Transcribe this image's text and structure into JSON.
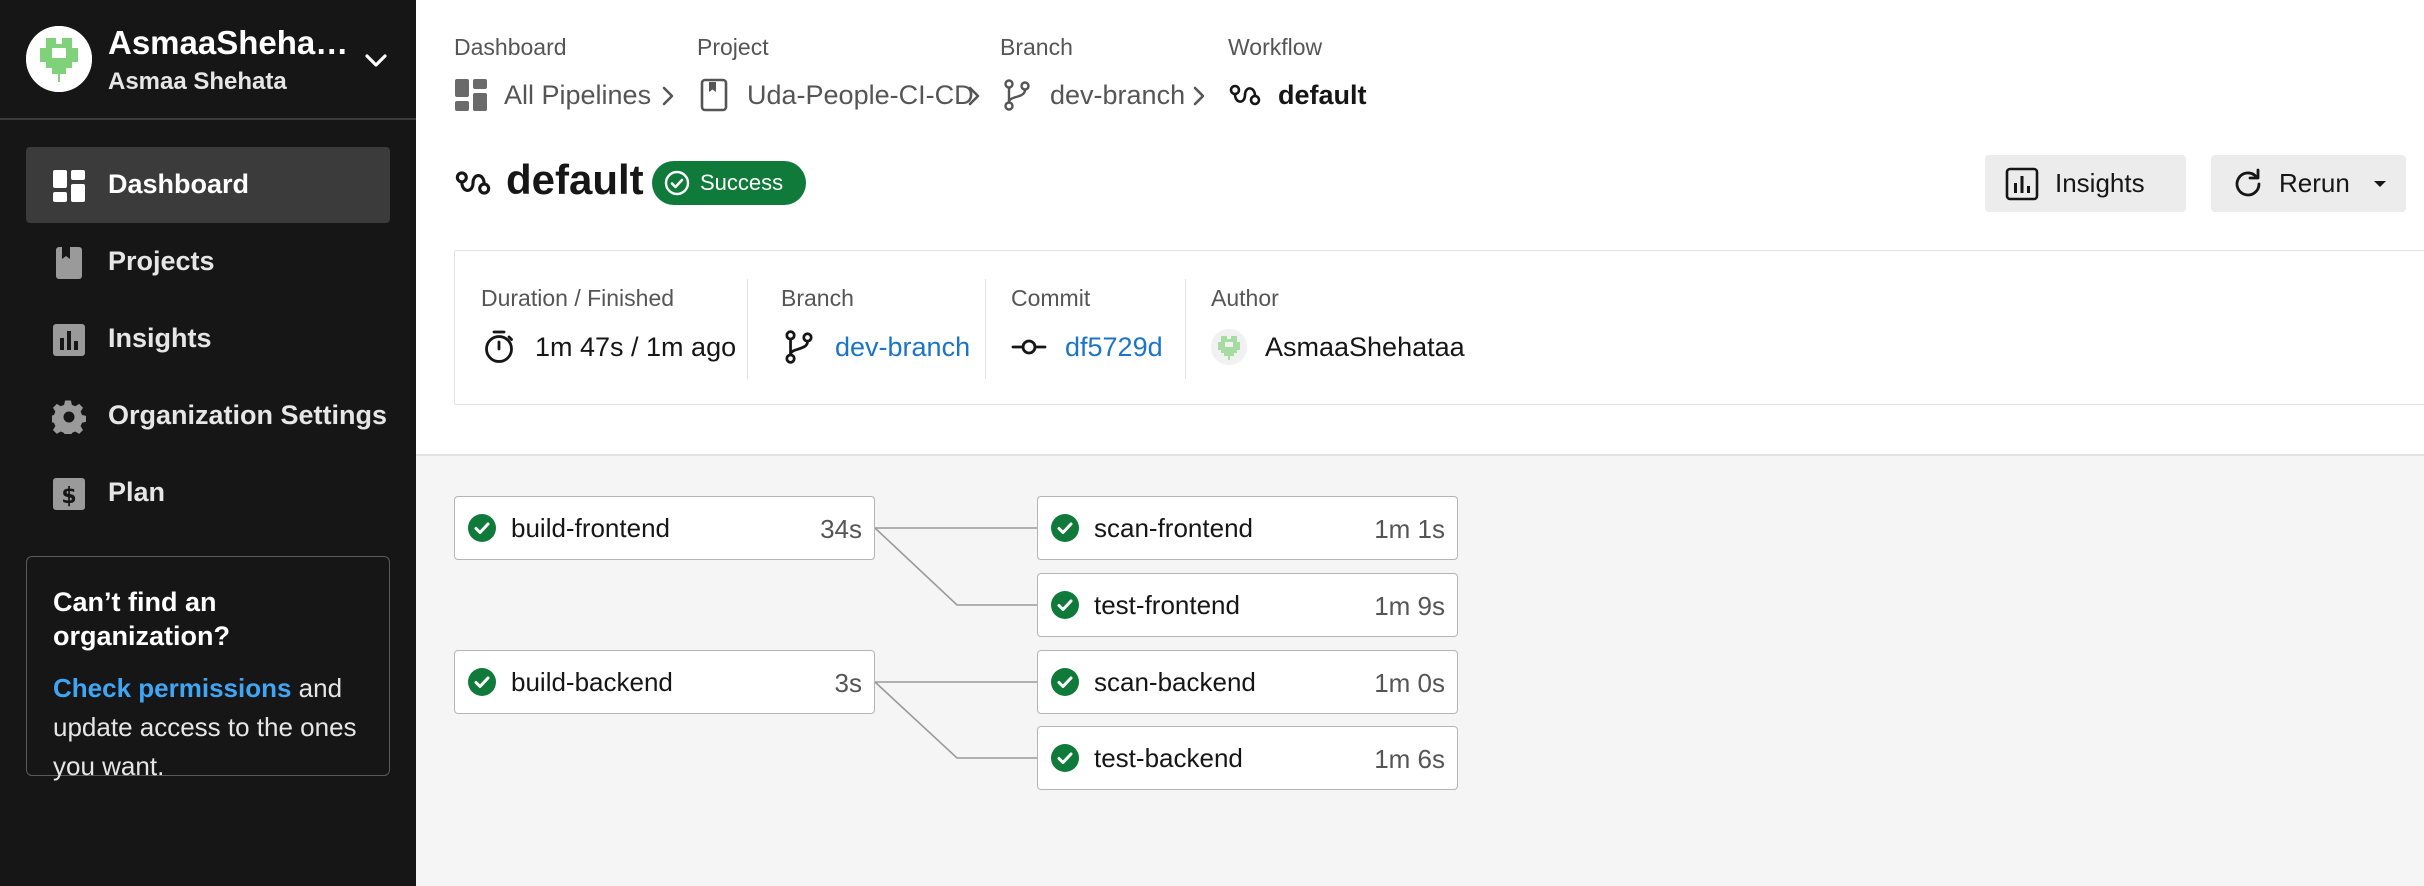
{
  "sidebar": {
    "org_name": "AsmaaShehat…",
    "org_user": "Asmaa Shehata",
    "nav": [
      {
        "label": "Dashboard",
        "icon": "dashboard-icon",
        "active": true
      },
      {
        "label": "Projects",
        "icon": "projects-icon",
        "active": false
      },
      {
        "label": "Insights",
        "icon": "insights-icon",
        "active": false
      },
      {
        "label": "Organization Settings",
        "icon": "gear-icon",
        "active": false
      },
      {
        "label": "Plan",
        "icon": "plan-icon",
        "active": false
      }
    ],
    "help": {
      "title": "Can’t find an organization?",
      "link": "Check permissions",
      "text": " and update access to the ones you want."
    }
  },
  "breadcrumb": [
    {
      "label": "Dashboard",
      "value": "All Pipelines",
      "icon": "pipelines-icon"
    },
    {
      "label": "Project",
      "value": "Uda-People-CI-CD",
      "icon": "project-icon"
    },
    {
      "label": "Branch",
      "value": "dev-branch",
      "icon": "branch-icon"
    },
    {
      "label": "Workflow",
      "value": "default",
      "icon": "workflow-icon"
    }
  ],
  "workflow": {
    "title": "default",
    "status": "Success"
  },
  "actions": {
    "insights_label": "Insights",
    "rerun_label": "Rerun"
  },
  "info": {
    "duration_label": "Duration / Finished",
    "duration_value": "1m 47s / 1m ago",
    "branch_label": "Branch",
    "branch_value": "dev-branch",
    "commit_label": "Commit",
    "commit_value": "df5729d",
    "author_label": "Author",
    "author_value": "AsmaaShehataa"
  },
  "jobs": {
    "build_frontend": {
      "name": "build-frontend",
      "duration": "34s",
      "status": "success"
    },
    "build_backend": {
      "name": "build-backend",
      "duration": "3s",
      "status": "success"
    },
    "scan_frontend": {
      "name": "scan-frontend",
      "duration": "1m 1s",
      "status": "success"
    },
    "test_frontend": {
      "name": "test-frontend",
      "duration": "1m 9s",
      "status": "success"
    },
    "scan_backend": {
      "name": "scan-backend",
      "duration": "1m 0s",
      "status": "success"
    },
    "test_backend": {
      "name": "test-backend",
      "duration": "1m 6s",
      "status": "success"
    }
  },
  "colors": {
    "sidebar_bg": "#161616",
    "success": "#0f7a3a",
    "link": "#1a75c8",
    "help_link": "#3ea6f4"
  }
}
